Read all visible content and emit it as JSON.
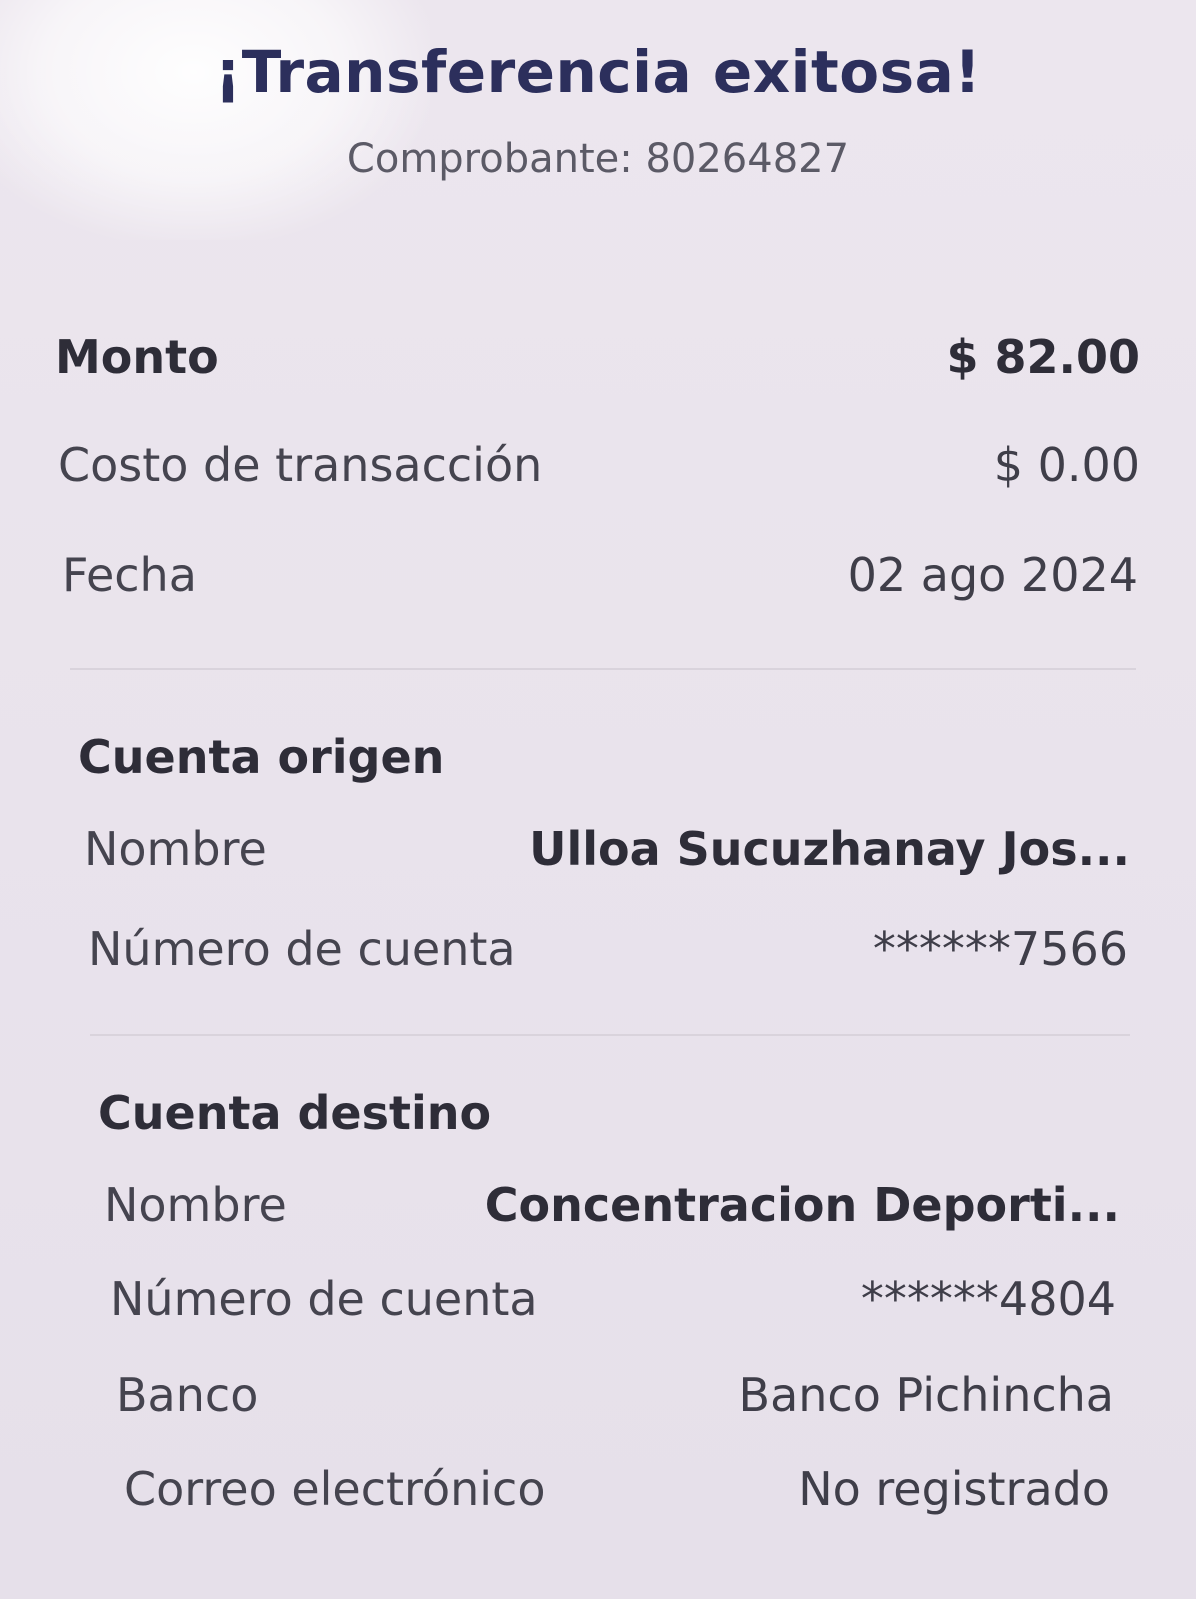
{
  "header": {
    "title": "¡Transferencia exitosa!",
    "receipt": "Comprobante: 80264827"
  },
  "summary": {
    "amount_label": "Monto",
    "amount_value": "$ 82.00",
    "fee_label": "Costo de transacción",
    "fee_value": "$ 0.00",
    "date_label": "Fecha",
    "date_value": "02 ago 2024"
  },
  "origin": {
    "title": "Cuenta origen",
    "name_label": "Nombre",
    "name_value": "Ulloa  Sucuzhanay Jos...",
    "account_label": "Número de cuenta",
    "account_value": "******7566"
  },
  "destination": {
    "title": "Cuenta destino",
    "name_label": "Nombre",
    "name_value": "Concentracion Deporti...",
    "account_label": "Número de cuenta",
    "account_value": "******4804",
    "bank_label": "Banco",
    "bank_value": "Banco Pichincha",
    "email_label": "Correo electrónico",
    "email_value": "No registrado"
  },
  "colors": {
    "title": "#2c2f5c",
    "background": "#eae4ed",
    "divider": "#d9d3dc"
  }
}
